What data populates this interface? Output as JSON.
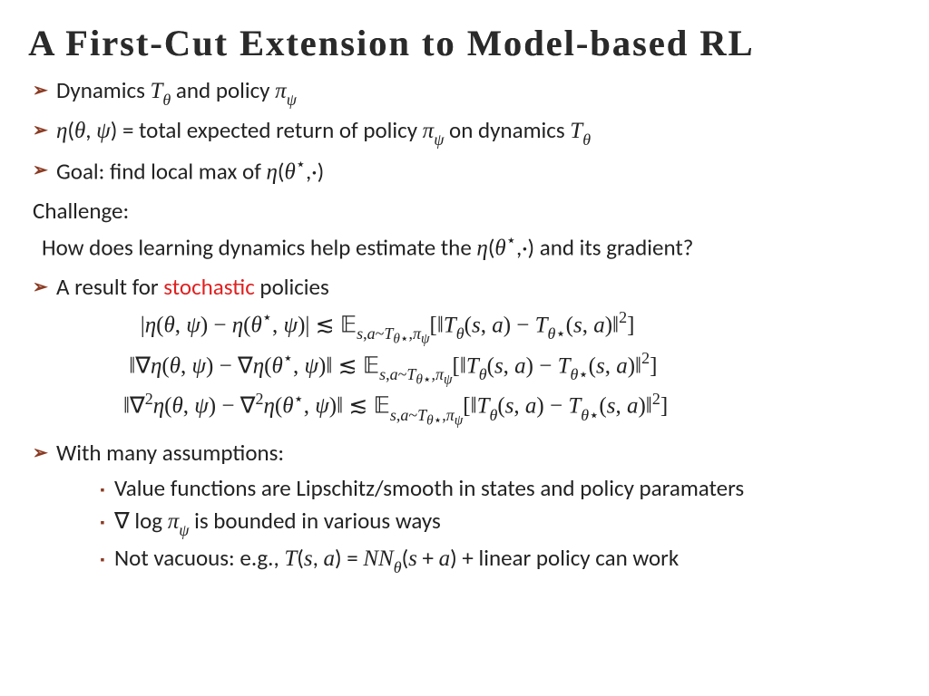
{
  "title": "A First-Cut Extension to Model-based RL",
  "b1_a": "Dynamics ",
  "b1_b": " and policy  ",
  "b2_a": " = total expected return of policy ",
  "b2_b": " on dynamics ",
  "b3_a": "Goal:  find local max of ",
  "challenge_label": "Challenge:",
  "challenge_text_a": "How does learning dynamics help estimate the ",
  "challenge_text_b": " and its gradient?",
  "b4_a": "A result for ",
  "b4_stochastic": "stochastic",
  "b4_b": " policies",
  "b5": "With many assumptions:",
  "s1": "Value functions are Lipschitz/smooth in states and policy paramaters",
  "s2_b": " is bounded in various ways",
  "s3_a": "Not vacuous: e.g., ",
  "s3_b": " + linear policy can work"
}
